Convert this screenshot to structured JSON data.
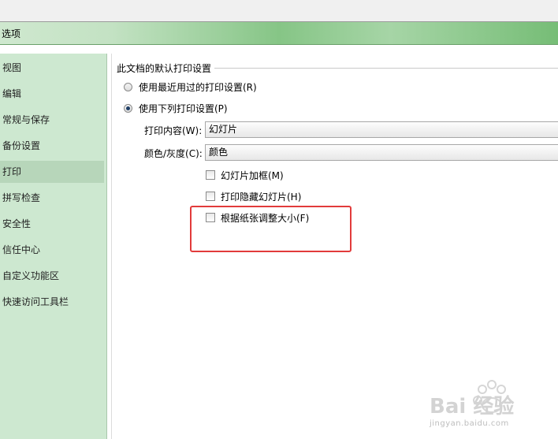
{
  "window": {
    "title": "选项"
  },
  "sidebar": {
    "items": [
      {
        "label": "视图"
      },
      {
        "label": "编辑"
      },
      {
        "label": "常规与保存"
      },
      {
        "label": "备份设置"
      },
      {
        "label": "打印"
      },
      {
        "label": "拼写检查"
      },
      {
        "label": "安全性"
      },
      {
        "label": "信任中心"
      },
      {
        "label": "自定义功能区"
      },
      {
        "label": "快速访问工具栏"
      }
    ],
    "selected": "打印"
  },
  "print": {
    "group_label": "此文档的默认打印设置",
    "radio_recent": "使用最近用过的打印设置(R)",
    "radio_following": "使用下列打印设置(P)",
    "content_label": "打印内容(W):",
    "content_value": "幻灯片",
    "color_label": "颜色/灰度(C):",
    "color_value": "颜色",
    "frame_slides": "幻灯片加框(M)",
    "print_hidden": "打印隐藏幻灯片(H)",
    "scale_to_paper": "根据纸张调整大小(F)"
  },
  "watermark": {
    "brand": "Bai  经验",
    "url": "jingyan.baidu.com"
  },
  "colors": {
    "sidebar_bg": "#cde8d0",
    "highlight": "#e23b3b"
  }
}
